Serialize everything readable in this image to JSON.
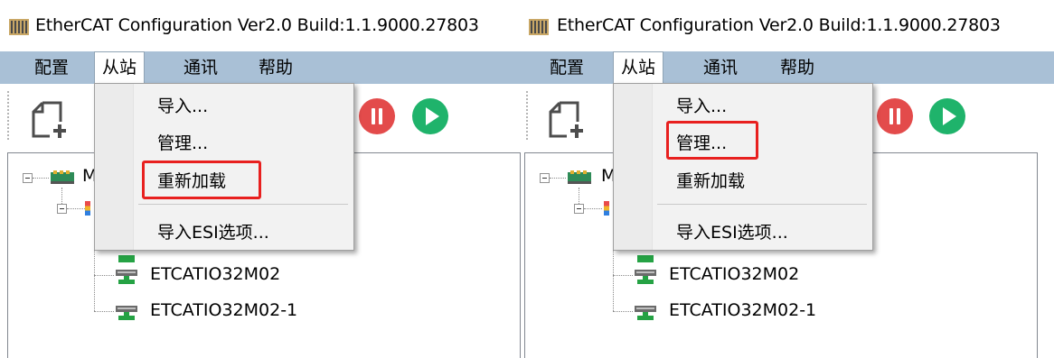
{
  "panels": [
    {
      "title": "EtherCAT Configuration   Ver2.0 Build:1.1.9000.27803",
      "menubar": [
        "配置",
        "从站",
        "通讯",
        "帮助"
      ],
      "active_menu": "从站",
      "dropdown": [
        "导入...",
        "管理...",
        "重新加载",
        "导入ESI选项..."
      ],
      "highlighted_item": "重新加载",
      "tree": {
        "root": "M",
        "devices": [
          "ETCATIO32M02",
          "ETCATIO32M02-1"
        ]
      }
    },
    {
      "title": "EtherCAT Configuration   Ver2.0 Build:1.1.9000.27803",
      "menubar": [
        "配置",
        "从站",
        "通讯",
        "帮助"
      ],
      "active_menu": "从站",
      "dropdown": [
        "导入...",
        "管理...",
        "重新加载",
        "导入ESI选项..."
      ],
      "highlighted_item": "管理...",
      "tree": {
        "root": "M",
        "devices": [
          "ETCATIO32M02",
          "ETCATIO32M02-1"
        ]
      }
    }
  ],
  "icons": [
    "app-icon",
    "new-file-icon",
    "pause-icon",
    "play-icon",
    "master-icon",
    "slave-icon"
  ],
  "colors": {
    "menubar": "#a9c0d6",
    "highlight": "#e8201f",
    "pause": "#e34b4b",
    "play": "#1fb36b",
    "slave_icon": "#25a244"
  }
}
